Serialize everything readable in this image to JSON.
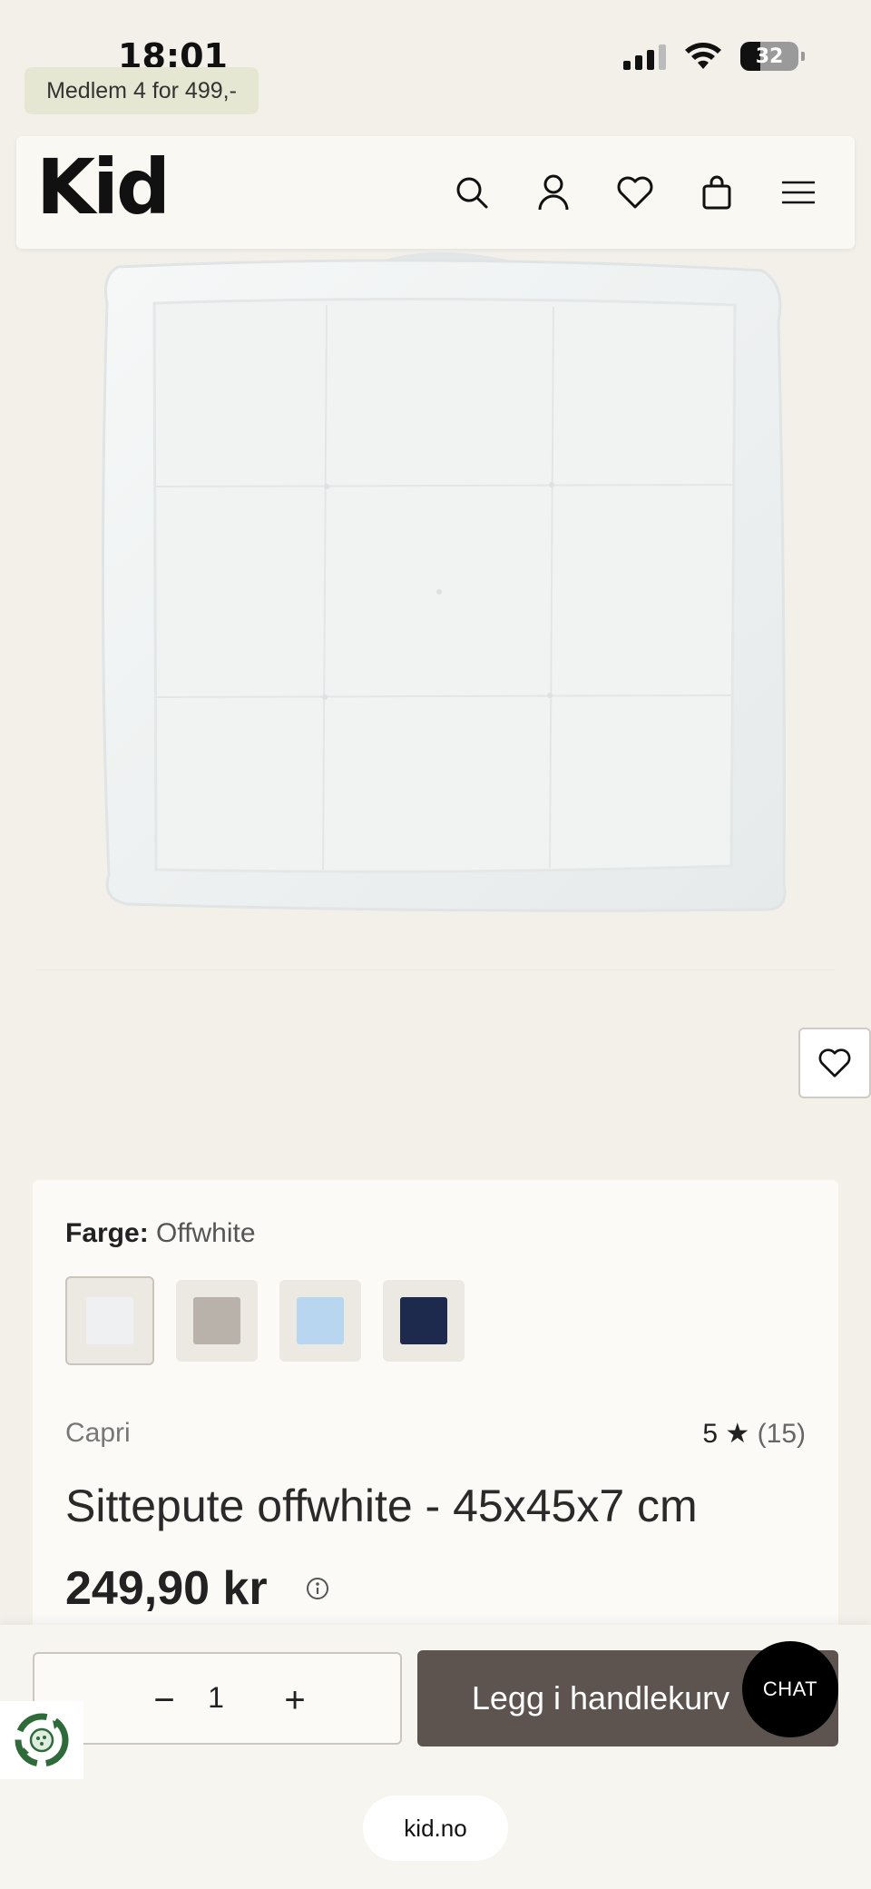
{
  "status_bar": {
    "time": "18:01",
    "battery_percent": "32",
    "icons": [
      "signal-icon",
      "wifi-icon",
      "battery-icon"
    ]
  },
  "promo": {
    "text": "Medlem 4 for 499,-"
  },
  "header": {
    "logo": "Kid",
    "icons": [
      "search-icon",
      "account-icon",
      "heart-icon",
      "bag-icon",
      "menu-icon"
    ]
  },
  "product": {
    "color_label": "Farge:",
    "color_value": "Offwhite",
    "swatch_colors": [
      "#eef0f1",
      "#b9b2aa",
      "#b9d6f0",
      "#1d2a4d"
    ],
    "brand": "Capri",
    "rating_value": "5",
    "rating_star": "★",
    "rating_count": "(15)",
    "title": "Sittepute offwhite - 45x45x7 cm",
    "price": "249,90 kr"
  },
  "cart": {
    "qty_minus": "−",
    "qty_value": "1",
    "qty_plus": "+",
    "add_label": "Legg i handlekurv",
    "chat_label": "CHAT"
  },
  "browser": {
    "url": "kid.no"
  },
  "colors": {
    "background": "#f3f0ea",
    "card": "#fbfaf7",
    "button": "#5d5450",
    "promo": "#e6e7d3"
  }
}
